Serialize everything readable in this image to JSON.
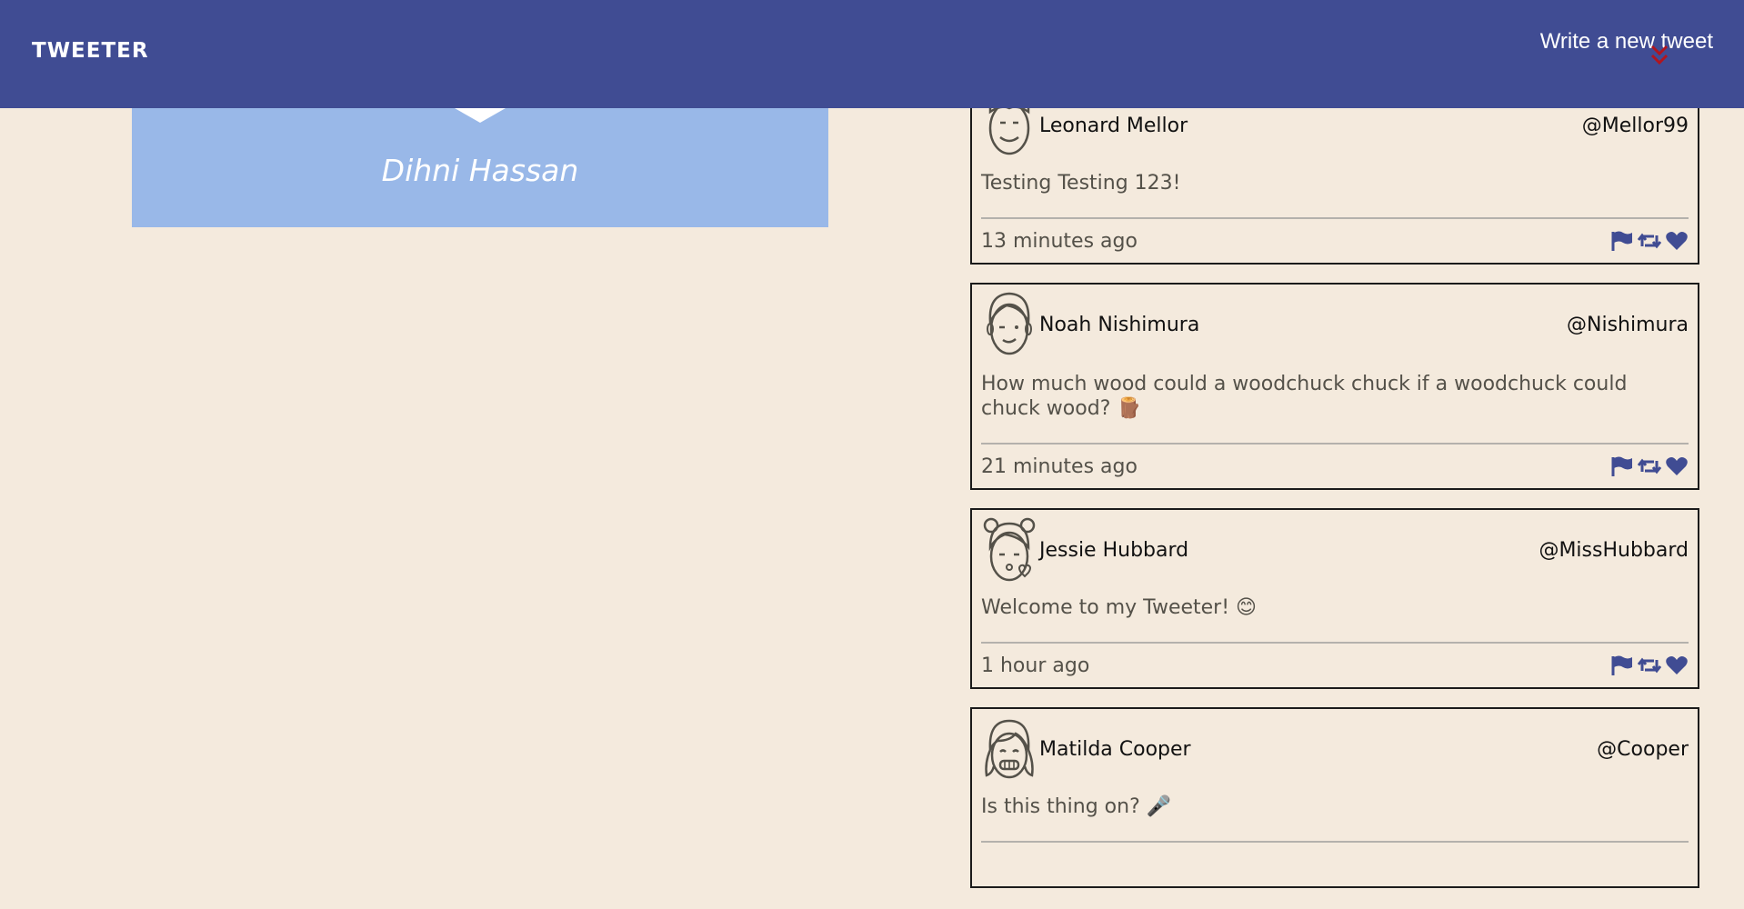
{
  "header": {
    "brand": "TWEETER",
    "compose_label": "Write a new tweet"
  },
  "profile": {
    "name": "Dihni Hassan"
  },
  "tweets": [
    {
      "name": "Leonard Mellor",
      "handle": "@Mellor99",
      "text": "Testing Testing 123!",
      "time": "13 minutes ago",
      "avatar": "man-smile-icon"
    },
    {
      "name": "Noah Nishimura",
      "handle": "@Nishimura",
      "text": "How much wood could a woodchuck chuck if a woodchuck could chuck wood? 🪵",
      "time": "21 minutes ago",
      "avatar": "boy-wink-icon"
    },
    {
      "name": "Jessie Hubbard",
      "handle": "@MissHubbard",
      "text": "Welcome to my Tweeter! 😊",
      "time": "1 hour ago",
      "avatar": "girl-kiss-icon"
    },
    {
      "name": "Matilda Cooper",
      "handle": "@Cooper",
      "text": "Is this thing on? 🎤",
      "time": "",
      "avatar": "girl-grin-icon"
    }
  ],
  "icons": {
    "flag": "flag-icon",
    "retweet": "retweet-icon",
    "like": "heart-icon",
    "compose": "double-chevron-down-icon"
  },
  "colors": {
    "nav": "#404c93",
    "background": "#f4eadd",
    "profile": "#99b8e8",
    "action_icons": "#404c93",
    "compose_arrow": "#b0151f"
  }
}
